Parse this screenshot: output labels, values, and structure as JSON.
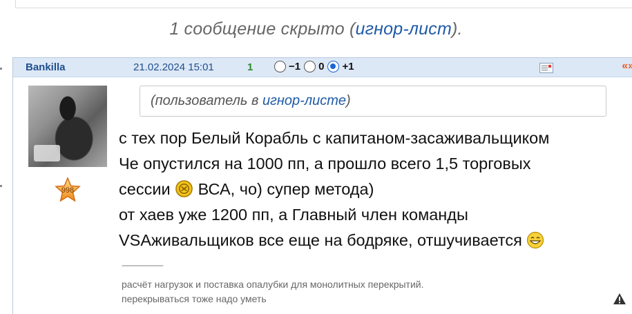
{
  "hidden_note": {
    "prefix": "1 сообщение скрыто (",
    "link": "игнор-лист",
    "suffix": ")."
  },
  "post": {
    "author": "Bankilla",
    "date": "21.02.2024 15:01",
    "score": "1",
    "votes": [
      {
        "label": "−1",
        "checked": false
      },
      {
        "label": "0",
        "checked": false
      },
      {
        "label": "+1",
        "checked": true
      }
    ],
    "quote_label": "«»",
    "rating_badge": "998",
    "ignore_notice": {
      "prefix": "(пользователь в ",
      "link": "игнор-листе",
      "suffix": ")"
    },
    "lines": [
      "с тех пор Белый Корабль с капитаном-засаживальщиком",
      "Че опустился на 1000 пп, а прошло всего 1,5 торговых",
      "сессии",
      "ВСА, чо) супер метода)",
      "от хаев уже 1200 пп, а Главный член команды",
      "VSAживальщиков все еще на бодряке, отшучивается"
    ],
    "signature_separator": "--------------------",
    "signature": [
      "расчёт нагрузок и поставка опалубки для монолитных перекрытий.",
      "перекрываться тоже надо уметь"
    ]
  },
  "colors": {
    "header_bg": "#dde8f6",
    "link": "#1f5aa6",
    "score": "#2b8a2b",
    "quote": "#e85b1f"
  },
  "icons": [
    "message-icon",
    "star-rank-icon",
    "coin-smiley-icon",
    "grin-smiley-icon",
    "warning-icon"
  ]
}
